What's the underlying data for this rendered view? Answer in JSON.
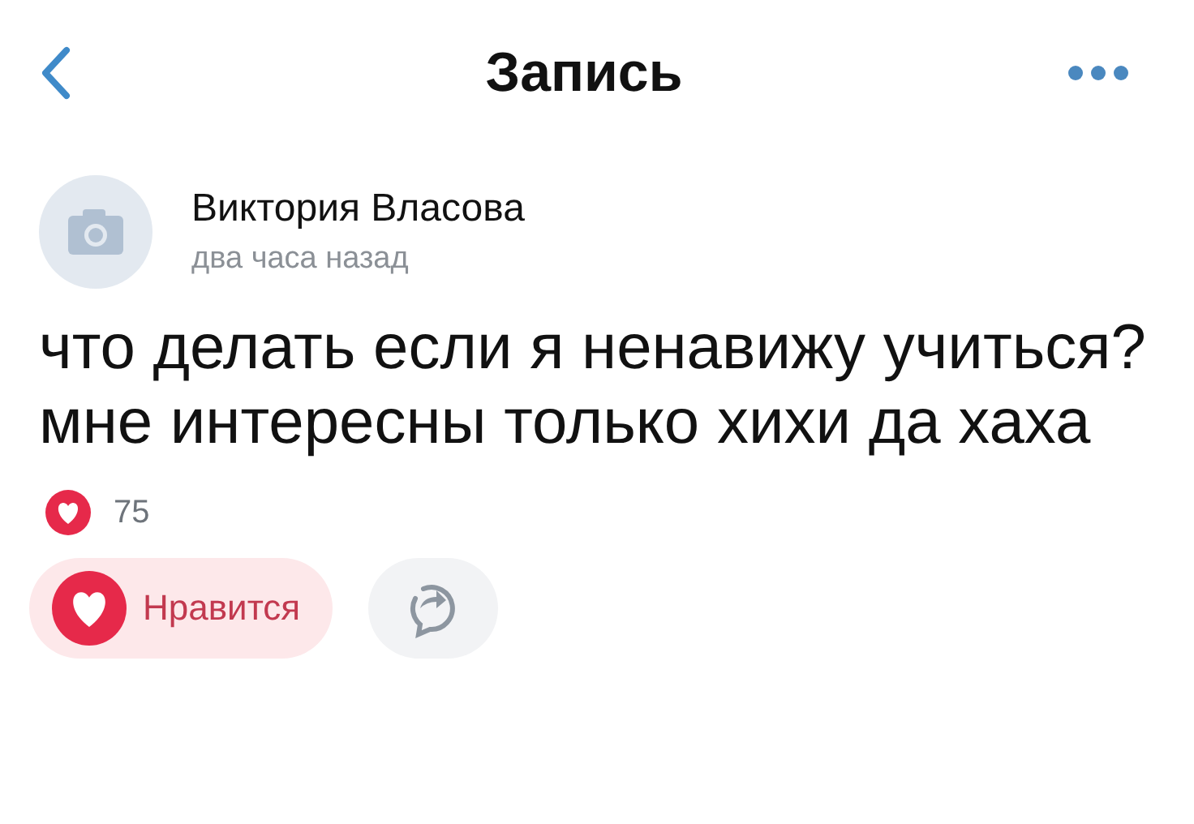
{
  "header": {
    "title": "Запись"
  },
  "post": {
    "author": "Виктория Власова",
    "time": "два часа назад",
    "lines": [
      "что делать если я ненавижу учиться?",
      "мне интересны только хихи да хаха"
    ],
    "likes_count": "75",
    "like_button": {
      "label": "Нравится",
      "liked": true
    }
  }
}
